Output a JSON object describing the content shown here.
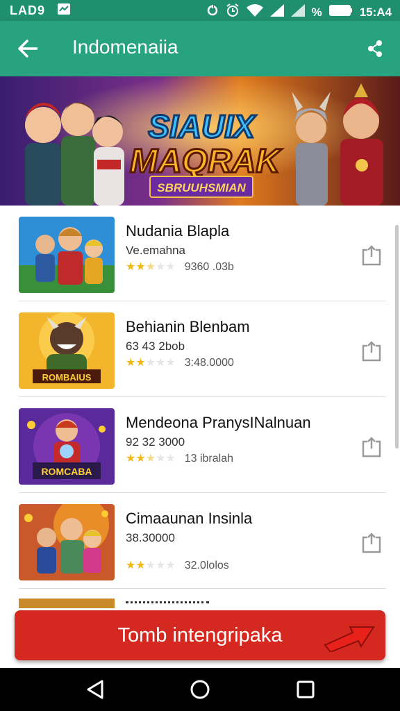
{
  "status_bar": {
    "carrier": "LAD9",
    "battery_pct": "%",
    "time": "15:A4"
  },
  "app_bar": {
    "title": "Indomenaiia"
  },
  "banner": {
    "title_line1": "SIAUIX",
    "title_line2": "MAQRAK",
    "subtitle": "SBRUUHSMIAN"
  },
  "items": [
    {
      "name": "Nudania Blapla",
      "subtitle": "Ve.emahna",
      "rating": 2.5,
      "size": "9360 .03b",
      "thumb_text": ""
    },
    {
      "name": "Behianin Blenbam",
      "subtitle": "63 43 2bob",
      "rating": 2,
      "size": "3:48.0000",
      "thumb_text": "ROMBAIUS"
    },
    {
      "name": "Mendeona PranysINalnuan",
      "subtitle": "92 32 3000",
      "rating": 2.5,
      "size": "13 ibralah",
      "thumb_text": "ROMCABA"
    },
    {
      "name": "Cimaaunan Insinla",
      "subtitle": "38.30000",
      "rating": 2,
      "size": "32.0lolos",
      "thumb_text": ""
    }
  ],
  "cta": {
    "label": "Tomb intengripaka"
  },
  "colors": {
    "appbar": "#27a37f",
    "statusbar": "#1f8f6e",
    "cta": "#d42820",
    "star": "#f2b818"
  }
}
